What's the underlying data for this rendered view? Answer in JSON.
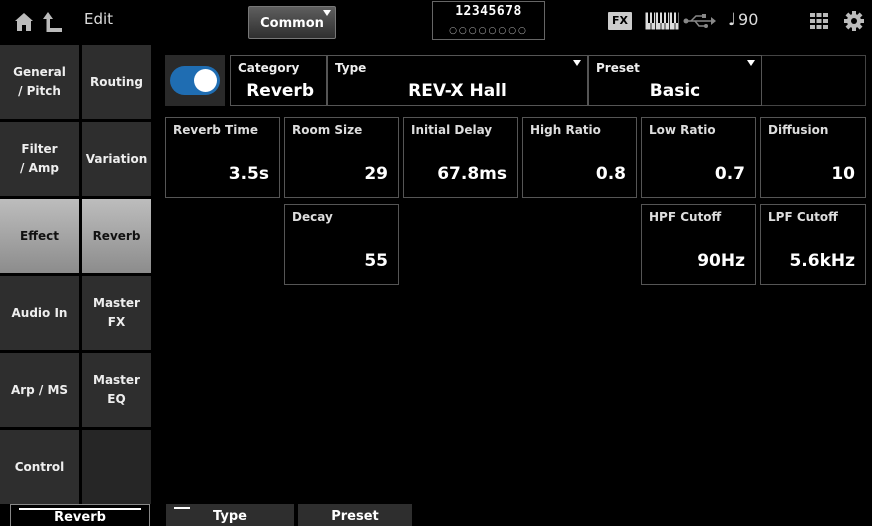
{
  "topbar": {
    "edit_label": "Edit",
    "common_label": "Common",
    "parts_numbers": "12345678",
    "parts_dots": "○○○○○○○○",
    "fx_label": "FX",
    "tempo_note": "♩",
    "tempo_value": "90"
  },
  "nav": {
    "col1": [
      "General\n/ Pitch",
      "Filter\n/ Amp",
      "Effect",
      "Audio In",
      "Arp / MS",
      "Control"
    ],
    "col2": [
      "Routing",
      "Variation",
      "Reverb",
      "Master\nFX",
      "Master\nEQ",
      ""
    ]
  },
  "header": {
    "category_label": "Category",
    "category_value": "Reverb",
    "type_label": "Type",
    "type_value": "REV-X Hall",
    "preset_label": "Preset",
    "preset_value": "Basic"
  },
  "params": {
    "reverb_time": {
      "label": "Reverb Time",
      "value": "3.5s"
    },
    "room_size": {
      "label": "Room Size",
      "value": "29"
    },
    "initial_delay": {
      "label": "Initial Delay",
      "value": "67.8ms"
    },
    "high_ratio": {
      "label": "High Ratio",
      "value": "0.8"
    },
    "low_ratio": {
      "label": "Low Ratio",
      "value": "0.7"
    },
    "diffusion": {
      "label": "Diffusion",
      "value": "10"
    },
    "decay": {
      "label": "Decay",
      "value": "55"
    },
    "hpf_cutoff": {
      "label": "HPF Cutoff",
      "value": "90Hz"
    },
    "lpf_cutoff": {
      "label": "LPF Cutoff",
      "value": "5.6kHz"
    }
  },
  "bottom_tabs": {
    "reverb": "Reverb",
    "type": "Type",
    "preset": "Preset"
  },
  "colors": {
    "toggle_on": "#1f6db2",
    "active_tab": "#a8a8a8"
  }
}
